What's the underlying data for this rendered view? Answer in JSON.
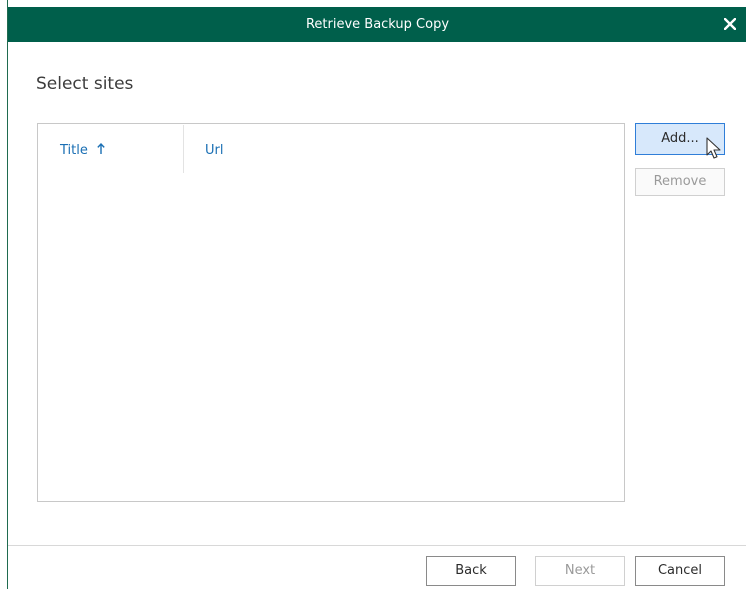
{
  "window": {
    "title": "Retrieve Backup Copy",
    "close_icon": "close-icon"
  },
  "heading": "Select sites",
  "table": {
    "columns": [
      {
        "label": "Title",
        "sort": "ascending"
      },
      {
        "label": "Url"
      }
    ],
    "rows": []
  },
  "side_buttons": {
    "add": "Add...",
    "remove": "Remove"
  },
  "footer": {
    "back": "Back",
    "next": "Next",
    "cancel": "Cancel"
  },
  "colors": {
    "titlebar": "#005f4b",
    "header_text": "#1a6fb4",
    "active_button_bg": "#d7e8fb",
    "active_button_border": "#2f7ed8"
  }
}
